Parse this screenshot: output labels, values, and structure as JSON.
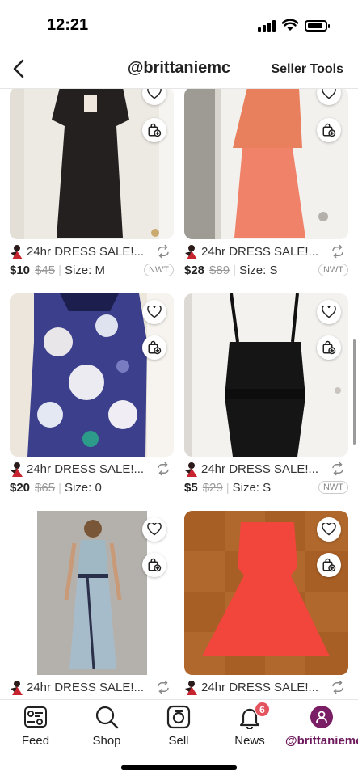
{
  "status_bar": {
    "time": "12:21"
  },
  "header": {
    "title": "@brittaniemc",
    "seller_tools_label": "Seller Tools"
  },
  "listings": [
    {
      "title": "24hr DRESS SALE!...",
      "price": "$10",
      "original_price": "$45",
      "size": "Size: M",
      "badge": "NWT"
    },
    {
      "title": "24hr DRESS SALE!...",
      "price": "$28",
      "original_price": "$89",
      "size": "Size: S",
      "badge": "NWT"
    },
    {
      "title": "24hr DRESS SALE!...",
      "price": "$20",
      "original_price": "$65",
      "size": "Size: 0",
      "badge": ""
    },
    {
      "title": "24hr DRESS SALE!...",
      "price": "$5",
      "original_price": "$29",
      "size": "Size: S",
      "badge": "NWT"
    },
    {
      "title": "24hr DRESS SALE!...",
      "price": "",
      "original_price": "",
      "size": "",
      "badge": ""
    },
    {
      "title": "24hr DRESS SALE!...",
      "price": "",
      "original_price": "",
      "size": "",
      "badge": ""
    }
  ],
  "tabbar": {
    "feed_label": "Feed",
    "shop_label": "Shop",
    "sell_label": "Sell",
    "news_label": "News",
    "news_badge": "6",
    "profile_label": "@brittaniemc"
  },
  "colors": {
    "accent": "#7a1f66",
    "badge": "#e4545f"
  }
}
